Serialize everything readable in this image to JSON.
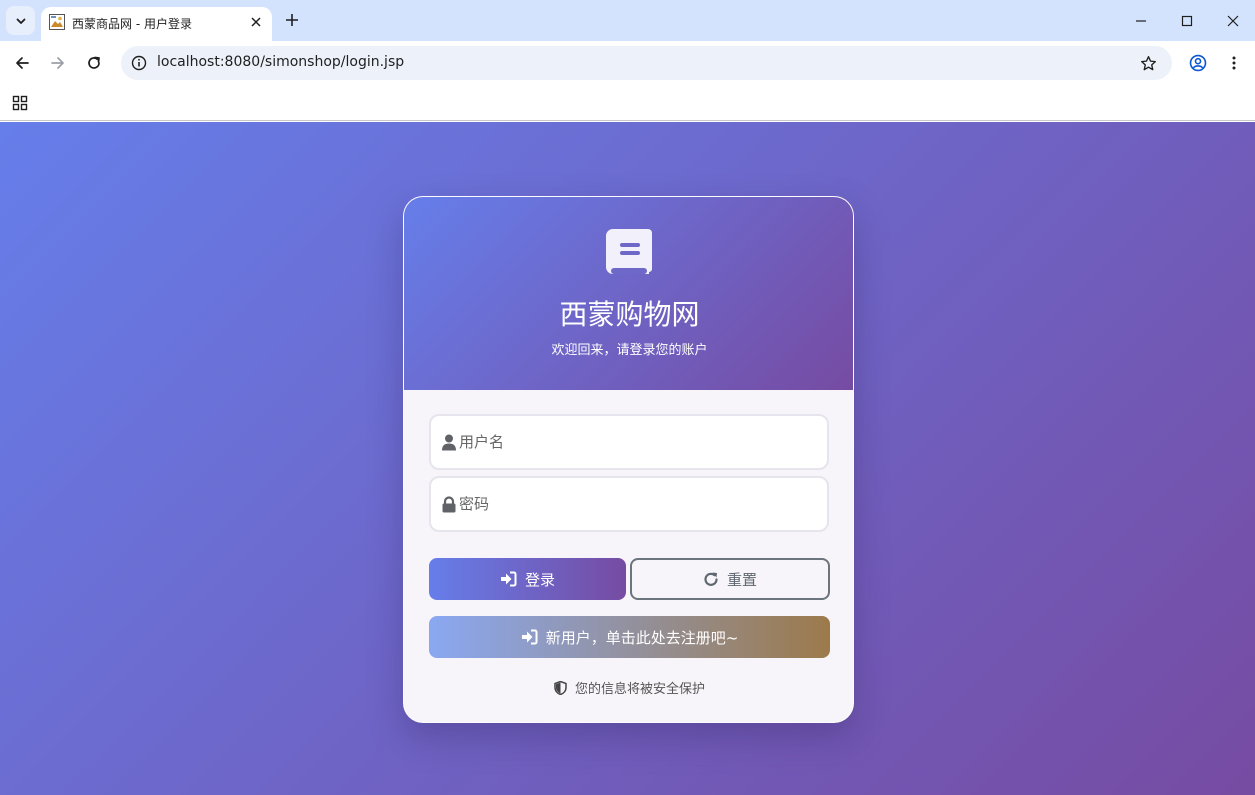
{
  "browser": {
    "tab_title": "西蒙商品网 - 用户登录",
    "url": "localhost:8080/simonshop/login.jsp"
  },
  "page": {
    "brand_title": "西蒙购物网",
    "subtitle": "欢迎回来，请登录您的账户",
    "username_placeholder": "用户名",
    "password_placeholder": "密码",
    "login_label": "登录",
    "reset_label": "重置",
    "register_label": "新用户，单击此处去注册吧~",
    "security_note": "您的信息将被安全保护"
  },
  "colors": {
    "background_start": "#667eea",
    "background_end": "#764ba2",
    "reset_border": "#6c757d",
    "register_end": "#9c7a4b"
  }
}
